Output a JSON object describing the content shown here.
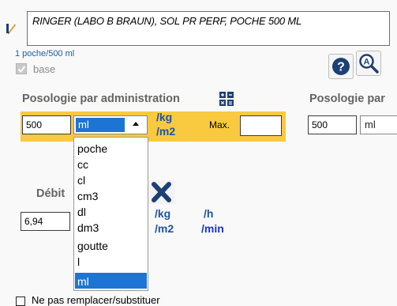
{
  "product": {
    "name": "RINGER (LABO B BRAUN), SOL PR PERF, POCHE 500 ML"
  },
  "presentation": {
    "caption": "1 poche/500 ml"
  },
  "base": {
    "label": "base",
    "checked": true
  },
  "posology": {
    "title": "Posologie par administration",
    "title_right": "Posologie par",
    "dose_value": "500",
    "unit_selected": "ml",
    "per_kg": "/kg",
    "per_m2": "/m2",
    "max_label": "Max.",
    "max_value": "",
    "dose_value_right": "500",
    "unit_selected_right": "ml"
  },
  "unit_options": [
    "poche",
    "cc",
    "cl",
    "cm3",
    "dl",
    "dm3",
    "goutte",
    "l",
    "ml"
  ],
  "debit": {
    "label": "Débit",
    "value": "6,94",
    "per_kg": "/kg",
    "per_m2": "/m2",
    "per_h": "/h",
    "per_min": "/min"
  },
  "substitution": {
    "label": "Ne pas remplacer/substituer"
  },
  "icons": {
    "pencil": "pencil-icon",
    "help": "help-icon",
    "search": "search-icon",
    "calculator": "calculator-icon",
    "close": "close-icon"
  },
  "colors": {
    "highlight_band": "#f9c940",
    "selection": "#1e74d2",
    "unit_text": "#1f53a5",
    "min_text": "#1a30d6",
    "help_bg": "#1d3f73"
  }
}
